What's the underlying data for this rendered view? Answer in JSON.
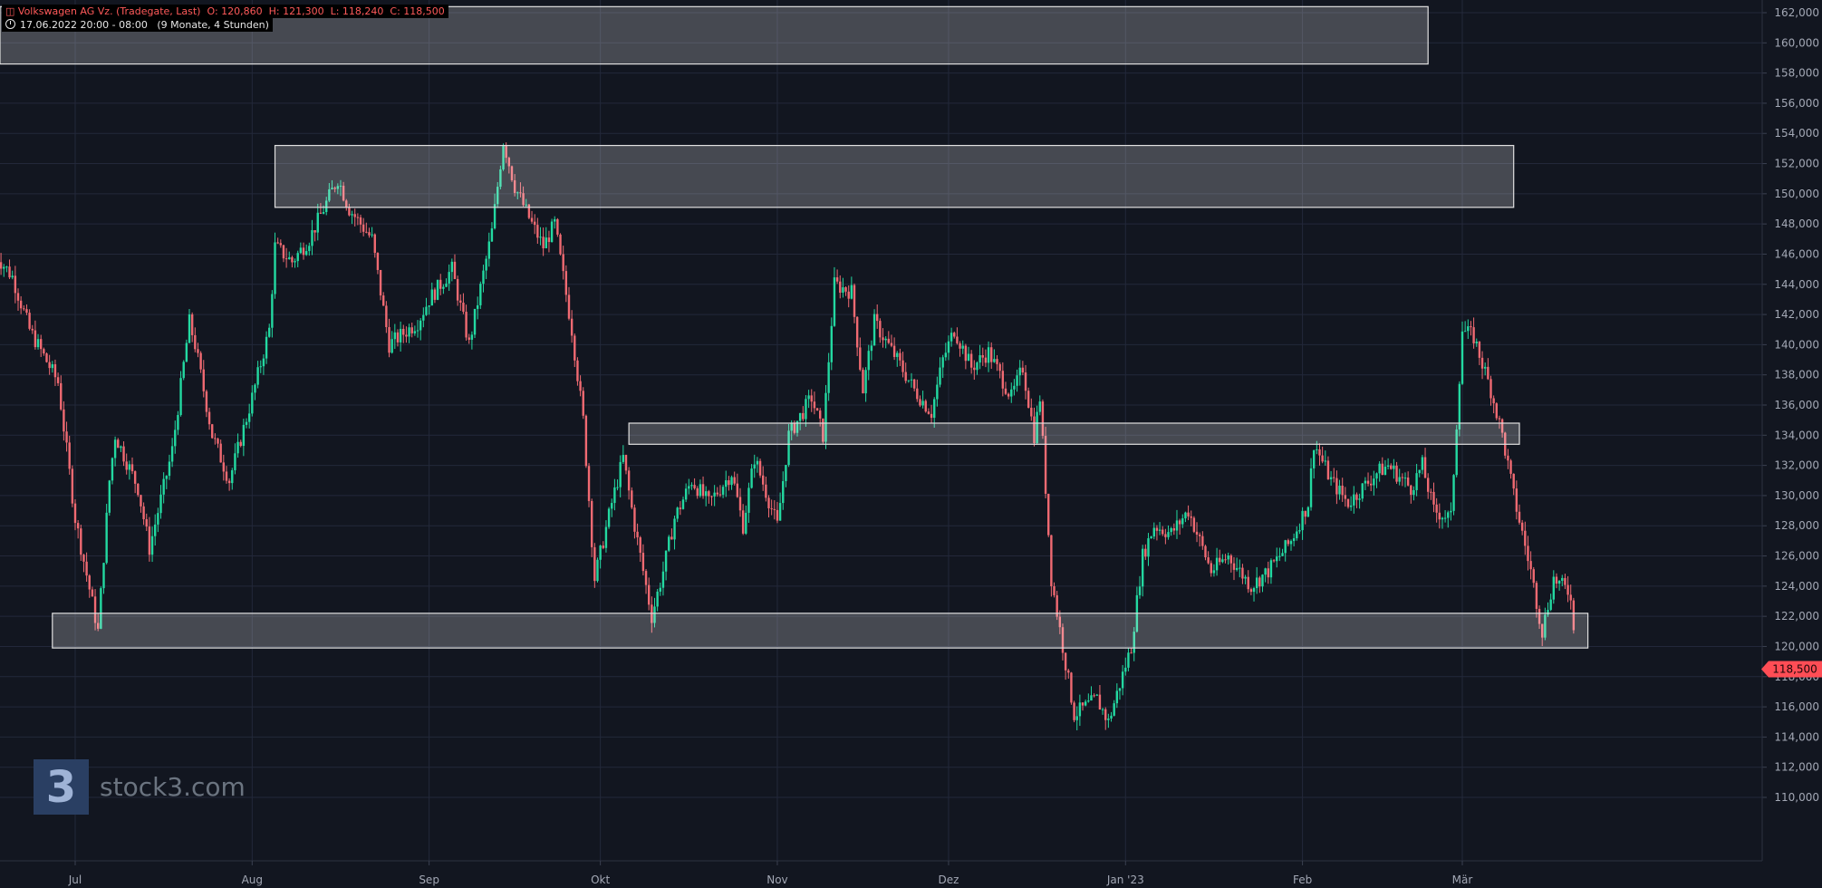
{
  "header": {
    "instrument": "Volkswagen AG Vz. (Tradegate, Last)",
    "ohlc": "O: 120,860  H: 121,300  L: 118,240  C: 118,500",
    "period": "17.06.2022 20:00 - 08:00",
    "span": "(9 Monate, 4 Stunden)"
  },
  "logo": {
    "mark": "3",
    "text": "stock3.com"
  },
  "colors": {
    "background": "#121620",
    "grid": "#23283a",
    "up": "#23d9a1",
    "down": "#f06a72",
    "zone_fill": "rgba(255,255,255,0.22)",
    "zone_stroke": "#e0e0e0",
    "axis_text": "#a3a8b5",
    "last_price_bg": "#ff4d55"
  },
  "chart_data": {
    "type": "candlestick",
    "title": "Volkswagen AG Vz. (Tradegate, Last)",
    "interval": "4 Stunden",
    "ylim": [
      109000,
      162800
    ],
    "y_ticks": [
      110000,
      112000,
      114000,
      116000,
      118000,
      120000,
      122000,
      124000,
      126000,
      128000,
      130000,
      132000,
      134000,
      136000,
      138000,
      140000,
      142000,
      144000,
      146000,
      148000,
      150000,
      152000,
      154000,
      156000,
      158000,
      160000,
      162000
    ],
    "y_tick_labels": [
      "110,000",
      "112,000",
      "114,000",
      "116,000",
      "118,000",
      "120,000",
      "122,000",
      "124,000",
      "126,000",
      "128,000",
      "130,000",
      "132,000",
      "134,000",
      "136,000",
      "138,000",
      "140,000",
      "142,000",
      "144,000",
      "146,000",
      "148,000",
      "150,000",
      "152,000",
      "154,000",
      "156,000",
      "158,000",
      "160,000",
      "162,000"
    ],
    "x_range": [
      "2022-06-17",
      "2023-03-24"
    ],
    "x_ticks": [
      {
        "date": "2022-07-01",
        "label": "Jul"
      },
      {
        "date": "2022-08-01",
        "label": "Aug"
      },
      {
        "date": "2022-09-01",
        "label": "Sep"
      },
      {
        "date": "2022-10-01",
        "label": "Okt"
      },
      {
        "date": "2022-11-01",
        "label": "Nov"
      },
      {
        "date": "2022-12-01",
        "label": "Dez"
      },
      {
        "date": "2023-01-01",
        "label": "Jan '23"
      },
      {
        "date": "2023-02-01",
        "label": "Feb"
      },
      {
        "date": "2023-03-01",
        "label": "Mär"
      }
    ],
    "price_path": [
      [
        "2022-06-17",
        146000
      ],
      [
        "2022-06-20",
        144500
      ],
      [
        "2022-06-23",
        141000
      ],
      [
        "2022-06-28",
        137500
      ],
      [
        "2022-06-30",
        131500
      ],
      [
        "2022-07-01",
        128500
      ],
      [
        "2022-07-05",
        121000
      ],
      [
        "2022-07-07",
        131000
      ],
      [
        "2022-07-08",
        134000
      ],
      [
        "2022-07-12",
        130500
      ],
      [
        "2022-07-14",
        126500
      ],
      [
        "2022-07-18",
        133000
      ],
      [
        "2022-07-21",
        141500
      ],
      [
        "2022-07-22",
        140000
      ],
      [
        "2022-07-25",
        134000
      ],
      [
        "2022-07-28",
        131000
      ],
      [
        "2022-08-01",
        136500
      ],
      [
        "2022-08-04",
        141000
      ],
      [
        "2022-08-05",
        146500
      ],
      [
        "2022-08-08",
        145500
      ],
      [
        "2022-08-11",
        147000
      ],
      [
        "2022-08-16",
        151000
      ],
      [
        "2022-08-18",
        149000
      ],
      [
        "2022-08-22",
        147000
      ],
      [
        "2022-08-25",
        140000
      ],
      [
        "2022-08-30",
        141500
      ],
      [
        "2022-09-01",
        143000
      ],
      [
        "2022-09-05",
        145000
      ],
      [
        "2022-09-08",
        140000
      ],
      [
        "2022-09-12",
        147500
      ],
      [
        "2022-09-14",
        153500
      ],
      [
        "2022-09-16",
        150500
      ],
      [
        "2022-09-19",
        148000
      ],
      [
        "2022-09-21",
        146500
      ],
      [
        "2022-09-23",
        148000
      ],
      [
        "2022-09-26",
        141000
      ],
      [
        "2022-09-28",
        135000
      ],
      [
        "2022-09-30",
        124500
      ],
      [
        "2022-10-03",
        129500
      ],
      [
        "2022-10-05",
        132500
      ],
      [
        "2022-10-07",
        128000
      ],
      [
        "2022-10-10",
        122000
      ],
      [
        "2022-10-12",
        125000
      ],
      [
        "2022-10-14",
        128500
      ],
      [
        "2022-10-17",
        131000
      ],
      [
        "2022-10-20",
        129500
      ],
      [
        "2022-10-24",
        131500
      ],
      [
        "2022-10-26",
        128000
      ],
      [
        "2022-10-28",
        132500
      ],
      [
        "2022-11-01",
        128000
      ],
      [
        "2022-11-03",
        134000
      ],
      [
        "2022-11-07",
        136500
      ],
      [
        "2022-11-09",
        134000
      ],
      [
        "2022-11-11",
        144000
      ],
      [
        "2022-11-14",
        143500
      ],
      [
        "2022-11-16",
        137000
      ],
      [
        "2022-11-18",
        141500
      ],
      [
        "2022-11-22",
        139000
      ],
      [
        "2022-11-25",
        137000
      ],
      [
        "2022-11-28",
        135500
      ],
      [
        "2022-11-30",
        139000
      ],
      [
        "2022-12-02",
        141000
      ],
      [
        "2022-12-05",
        138500
      ],
      [
        "2022-12-08",
        139500
      ],
      [
        "2022-12-12",
        136500
      ],
      [
        "2022-12-14",
        138500
      ],
      [
        "2022-12-16",
        134000
      ],
      [
        "2022-12-17",
        136500
      ],
      [
        "2022-12-19",
        124500
      ],
      [
        "2022-12-21",
        120000
      ],
      [
        "2022-12-23",
        115500
      ],
      [
        "2022-12-27",
        116500
      ],
      [
        "2022-12-29",
        115000
      ],
      [
        "2023-01-02",
        120000
      ],
      [
        "2023-01-04",
        126000
      ],
      [
        "2023-01-06",
        128000
      ],
      [
        "2023-01-09",
        127500
      ],
      [
        "2023-01-12",
        129000
      ],
      [
        "2023-01-16",
        125000
      ],
      [
        "2023-01-19",
        126000
      ],
      [
        "2023-01-23",
        124000
      ],
      [
        "2023-01-26",
        125000
      ],
      [
        "2023-01-30",
        127000
      ],
      [
        "2023-02-02",
        129500
      ],
      [
        "2023-02-03",
        133500
      ],
      [
        "2023-02-06",
        131000
      ],
      [
        "2023-02-09",
        129500
      ],
      [
        "2023-02-14",
        131500
      ],
      [
        "2023-02-16",
        132000
      ],
      [
        "2023-02-20",
        130500
      ],
      [
        "2023-02-22",
        132000
      ],
      [
        "2023-02-24",
        129000
      ],
      [
        "2023-02-27",
        128500
      ],
      [
        "2023-03-01",
        141000
      ],
      [
        "2023-03-03",
        140500
      ],
      [
        "2023-03-06",
        137000
      ],
      [
        "2023-03-08",
        134000
      ],
      [
        "2023-03-10",
        130000
      ],
      [
        "2023-03-13",
        125000
      ],
      [
        "2023-03-15",
        121000
      ],
      [
        "2023-03-17",
        124500
      ],
      [
        "2023-03-20",
        123500
      ],
      [
        "2023-03-21",
        118500
      ]
    ],
    "zones": [
      {
        "x_from": "2022-06-17",
        "x_to": "2023-02-23",
        "y_from": 158600,
        "y_to": 162400
      },
      {
        "x_from": "2022-08-05",
        "x_to": "2023-03-10",
        "y_from": 149100,
        "y_to": 153200
      },
      {
        "x_from": "2022-10-06",
        "x_to": "2023-03-11",
        "y_from": 133400,
        "y_to": 134800
      },
      {
        "x_from": "2022-06-27",
        "x_to": "2023-03-23",
        "y_from": 119900,
        "y_to": 122200
      }
    ],
    "last_price": 118500,
    "last_price_label": "118,500",
    "grid": true,
    "legend": "none"
  }
}
